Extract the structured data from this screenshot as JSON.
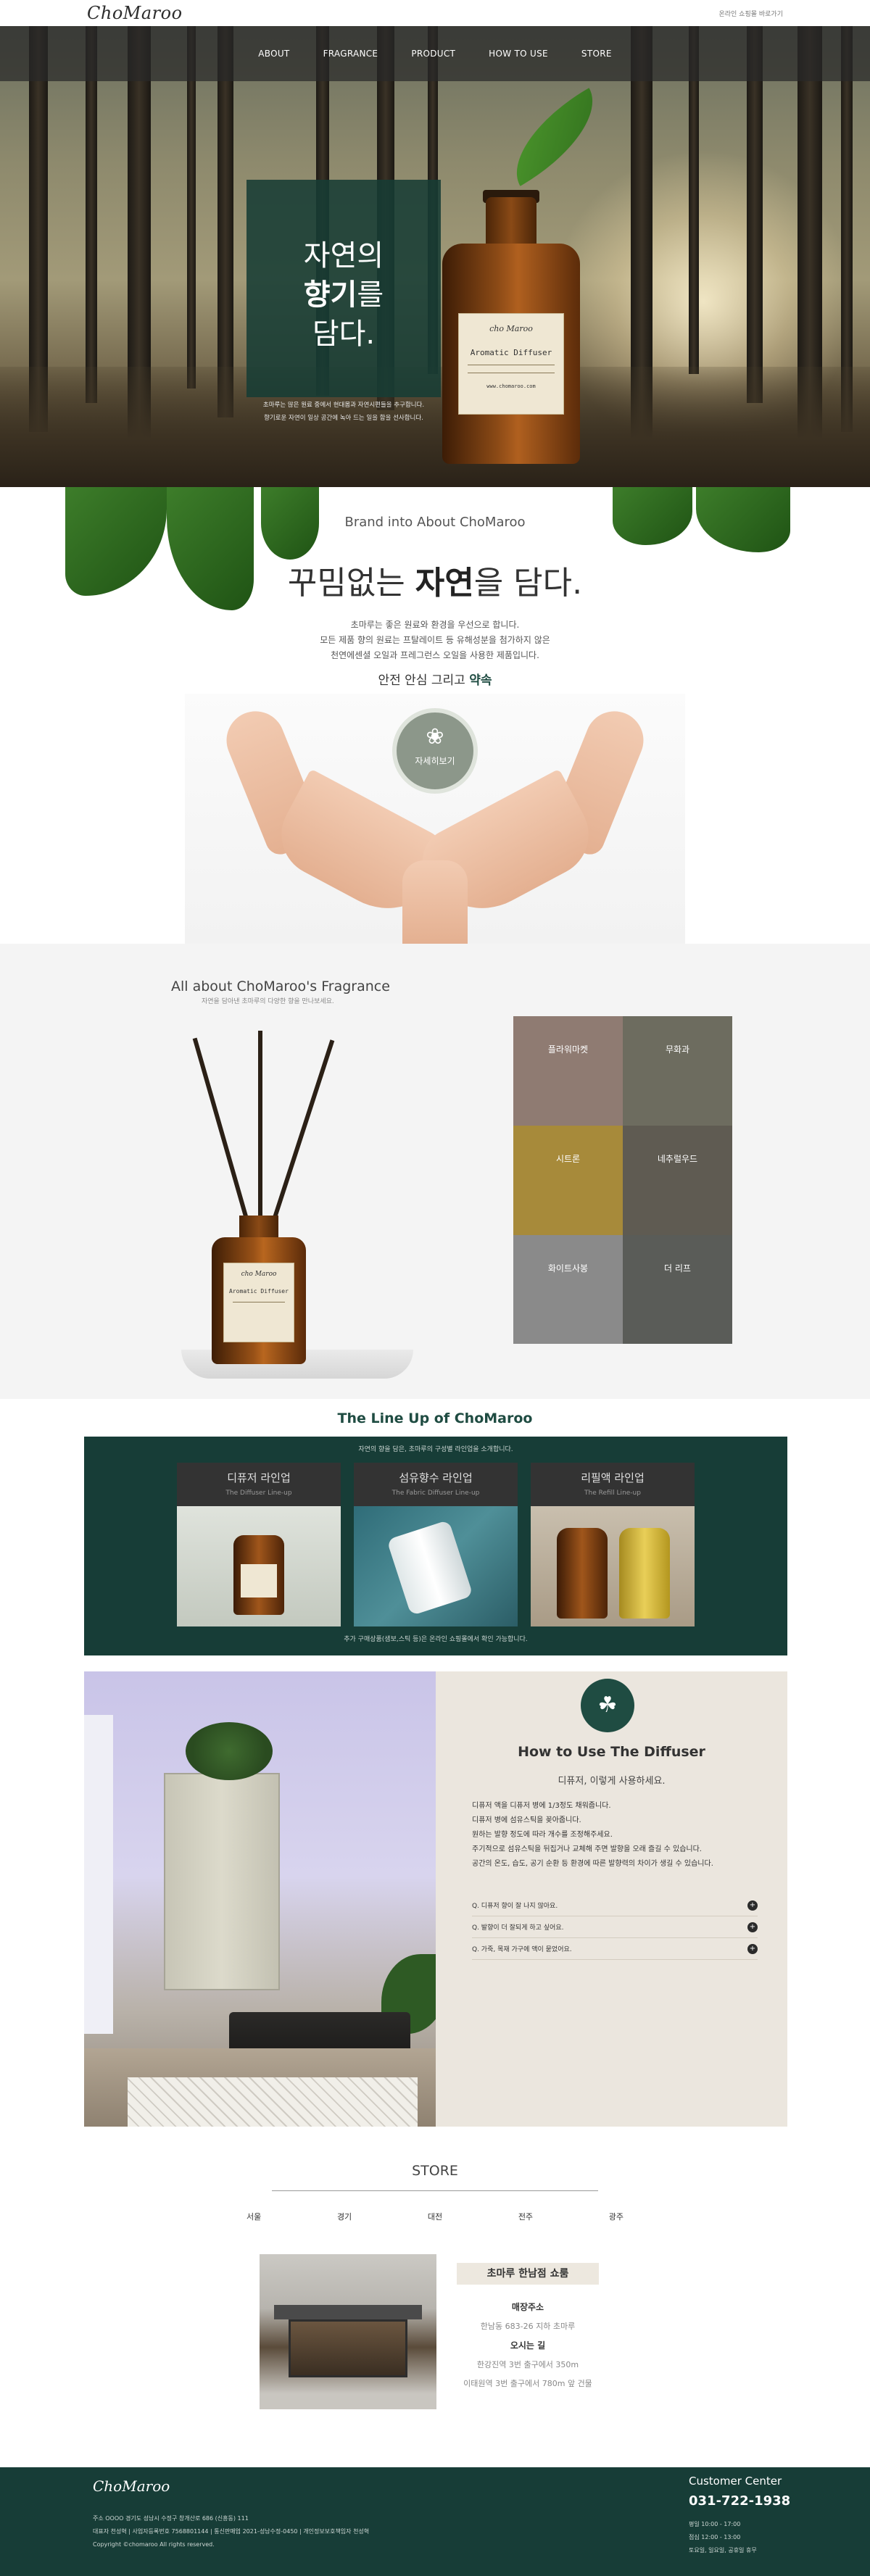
{
  "brand": {
    "logo": "ChoMaroo"
  },
  "topbar": {
    "mall_link": "온라인 쇼핑몰 바로가기"
  },
  "nav": {
    "items": [
      "ABOUT",
      "FRAGRANCE",
      "PRODUCT",
      "HOW TO USE",
      "STORE"
    ]
  },
  "hero": {
    "title_line1": "자연의",
    "title_line2_bold": "향기",
    "title_line2_rest": "를",
    "title_line3": "담다.",
    "sub_line1": "초마루는 많은 원료 중에서 현대몸과 자연시편들을 추구합니다.",
    "sub_line2": "향기로운 자연이 일상 공간에 녹아 드는 일을 함을 선사합니다.",
    "label_top": "cho Maroo",
    "label_name": "Aromatic Diffuser",
    "label_bottom": "www.chomaroo.com"
  },
  "about": {
    "brand_line": "Brand into About ChoMaroo",
    "headline_pre": "꾸밈없는 ",
    "headline_bold": "자연",
    "headline_post": "을 담다.",
    "p1": "초마루는 좋은 원료와 환경을 우선으로 합니다.",
    "p2": "모든 제품 향의 원료는 프탈레이트 등 유해성분을 첨가하지 않은",
    "p3": "천연에센셜 오일과 프레그런스 오일을 사용한 제품입니다.",
    "safe_pre": "안전 안심 그리고 ",
    "safe_bold": "약속",
    "more_label": "자세히보기"
  },
  "fragrance": {
    "title": "All about ChoMaroo's Fragrance",
    "sub": "자연을 담아낸 초마루의 다양한 향을 만나보세요.",
    "label_top": "cho Maroo",
    "label_name": "Aromatic Diffuser",
    "tiles": [
      {
        "label": "플라워마켓",
        "color": "#8f7b72"
      },
      {
        "label": "무화과",
        "color": "#6d6c5f"
      },
      {
        "label": "시트론",
        "color": "#a78a3a"
      },
      {
        "label": "네추럴우드",
        "color": "#5f5b52"
      },
      {
        "label": "화이트사봉",
        "color": "#8a8a8a"
      },
      {
        "label": "더 리프",
        "color": "#5a5c58"
      }
    ]
  },
  "lineup": {
    "title": "The Line Up of ChoMaroo",
    "sub": "자연의 향을 담은, 초마루의 구성별 라인업을 소개합니다.",
    "cards": [
      {
        "ko": "디퓨저 라인업",
        "en": "The Diffuser Line-up",
        "bg": "#d4d8d2"
      },
      {
        "ko": "섬유향수 라인업",
        "en": "The Fabric Diffuser Line-up",
        "bg": "#3f7c88"
      },
      {
        "ko": "리필액 라인업",
        "en": "The Refill Line-up",
        "bg": "#bfb3a1"
      }
    ],
    "note": "추가 구매상품(샘보,스틱 등)은 온라인 쇼핑몰에서 확인 가능합니다."
  },
  "howto": {
    "title": "How to Use The Diffuser",
    "sub": "디퓨저, 이렇게 사용하세요.",
    "steps": [
      "디퓨저 액을 디퓨저 병에 1/3정도 채워줍니다.",
      "디퓨저 병에 섬유스틱을 꽂아줍니다.",
      "원하는 발향 정도에 따라 개수를 조정해주세요.",
      "주기적으로 섬유스틱을 뒤집거나 교체해 주면 발향을 오래 즐길 수 있습니다.",
      "공간의 온도, 습도, 공기 순환 등 환경에 따른 발향력의 차이가 생길 수 있습니다."
    ],
    "faqs": [
      "Q. 디퓨저 향이 잘 나지 않아요.",
      "Q. 발향이 더 잘되게 하고 싶어요.",
      "Q. 가죽, 목재 가구에 액이 묻었어요."
    ]
  },
  "store": {
    "title": "STORE",
    "tabs": [
      "서울",
      "경기",
      "대전",
      "전주",
      "광주"
    ],
    "name": "초마루 한남점 쇼룸",
    "addr_label": "매장주소",
    "addr": "한남동 683-26 지하 초마루",
    "route_label": "오시는 길",
    "route1": "한강진역 3번 출구에서 350m",
    "route2": "이태원역 3번 출구에서 780m 앞 건물"
  },
  "footer": {
    "logo": "ChoMaroo",
    "line1": "주소 OOOO 경기도 성남시 수정구 창개산로 686 (신흥동) 111",
    "line2": "대표자 천성혁 | 사업자등록번호 7568801144 | 통신판매업 2021-성남수정-0450 | 개인정보보호책임자 천성혁",
    "line3": "Copyright ©chomaroo All rights reserved.",
    "cc_title": "Customer Center",
    "phone": "031-722-1938",
    "hours1": "평일 10:00 - 17:00",
    "hours2": "점심 12:00 - 13:00",
    "hours3": "토요일, 일요일, 공휴일 휴무"
  },
  "colors": {
    "brand_green": "#1f4c42",
    "footer_bg": "#173d37",
    "howto_bg": "#ebe6de"
  }
}
